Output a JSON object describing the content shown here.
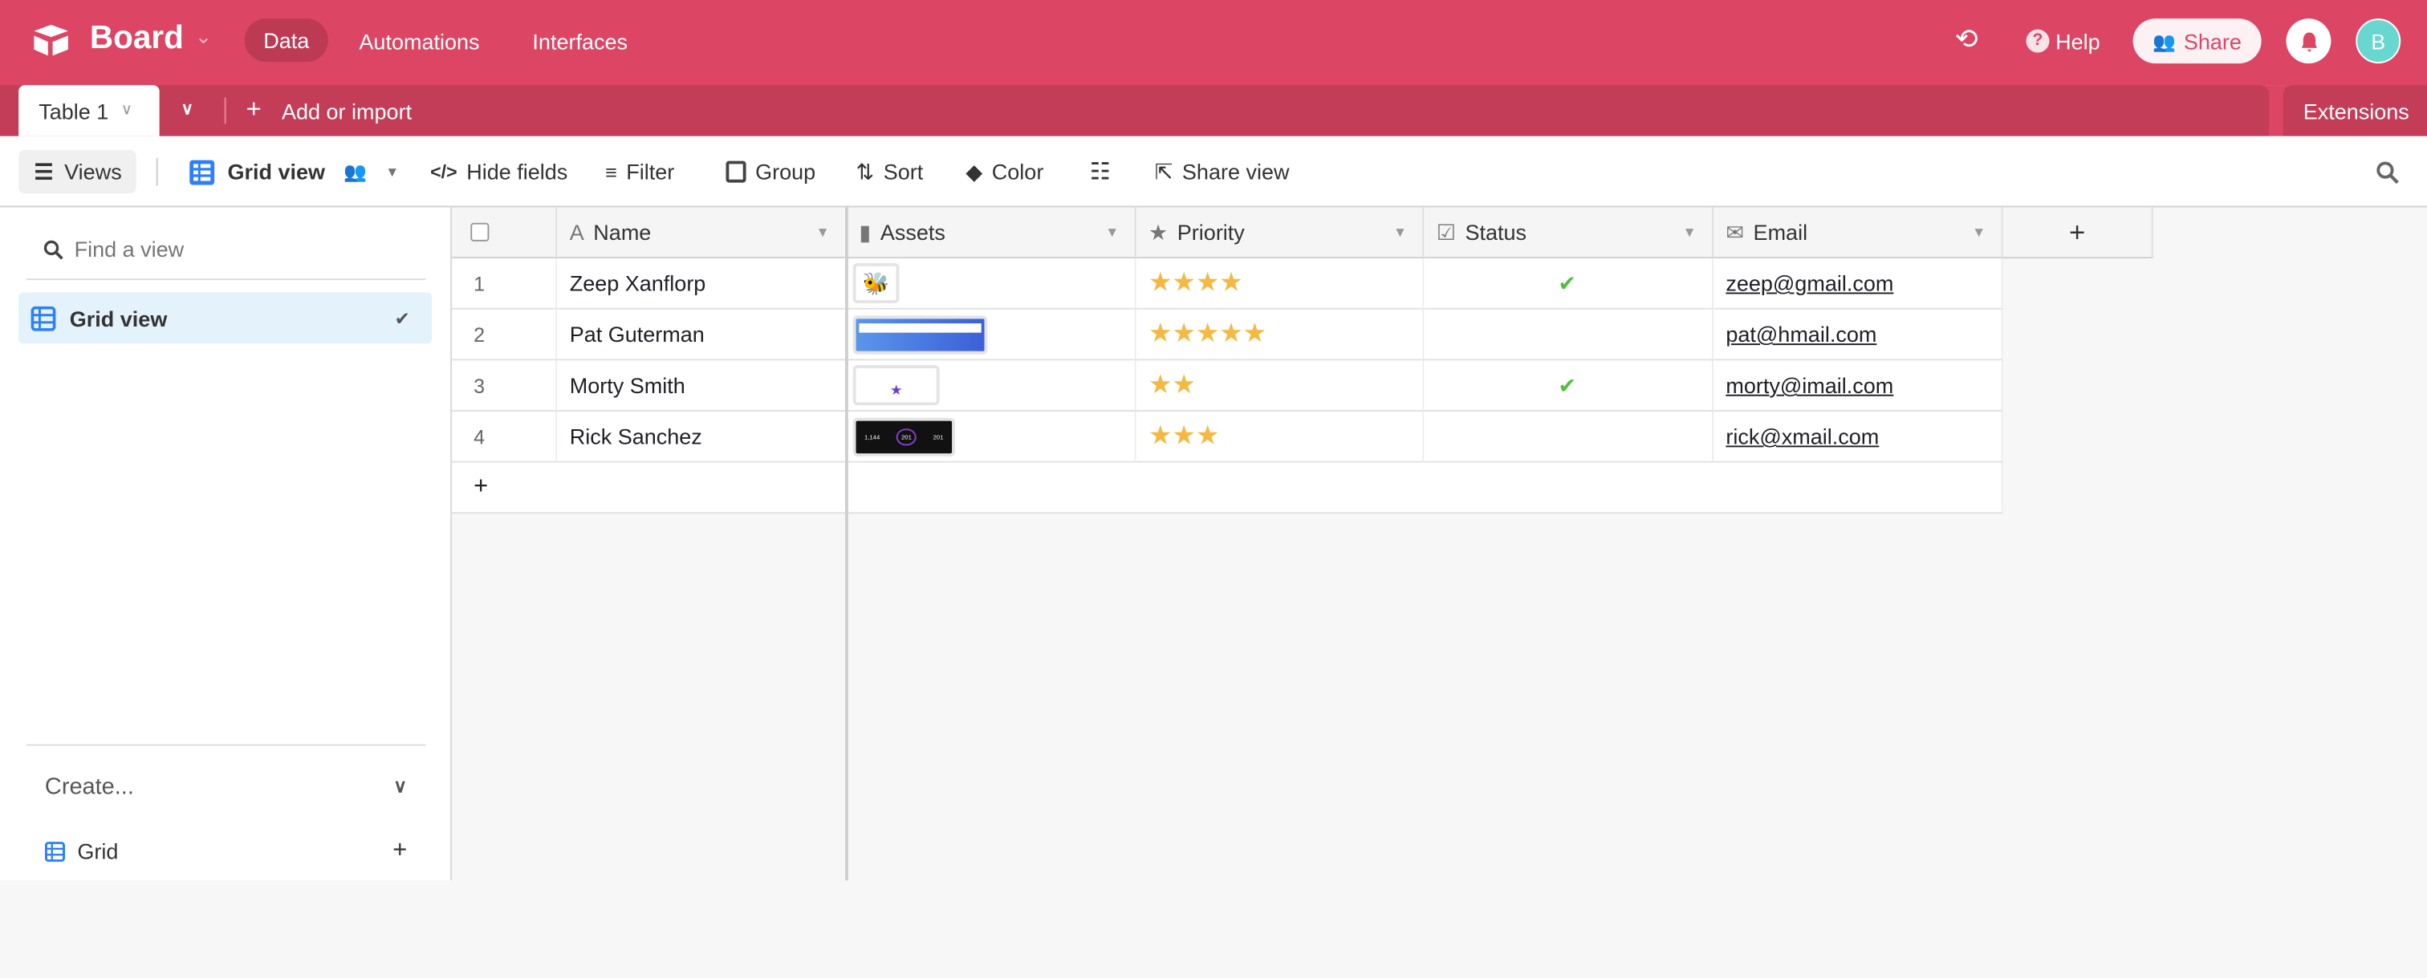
{
  "app": {
    "title": "Board",
    "nav": [
      "Data",
      "Automations",
      "Interfaces"
    ],
    "help": "Help",
    "share": "Share",
    "avatar": "B",
    "brand_color": "#dc4563",
    "avatar_color": "#68d7d0"
  },
  "tabs": {
    "table": "Table 1",
    "add": "Add or import",
    "extensions": "Extensions"
  },
  "toolbar": {
    "views": "Views",
    "view_name": "Grid view",
    "hide_fields": "Hide fields",
    "filter": "Filter",
    "group": "Group",
    "sort": "Sort",
    "color": "Color",
    "share_view": "Share view"
  },
  "sidebar": {
    "find_placeholder": "Find a view",
    "items": [
      {
        "label": "Grid view",
        "selected": true
      }
    ],
    "create": "Create...",
    "create_items": [
      {
        "label": "Grid"
      }
    ]
  },
  "grid": {
    "columns": [
      {
        "label": "Name",
        "icon": "text-icon"
      },
      {
        "label": "Assets",
        "icon": "file-icon"
      },
      {
        "label": "Priority",
        "icon": "star-icon"
      },
      {
        "label": "Status",
        "icon": "checkbox-icon"
      },
      {
        "label": "Email",
        "icon": "mail-icon"
      }
    ],
    "rows": [
      {
        "num": "1",
        "name": "Zeep Xanflorp",
        "asset": "bee",
        "priority": 4,
        "status": true,
        "email": "zeep@gmail.com"
      },
      {
        "num": "2",
        "name": "Pat Guterman",
        "asset": "blue-screenshot",
        "priority": 5,
        "status": false,
        "email": "pat@hmail.com"
      },
      {
        "num": "3",
        "name": "Morty Smith",
        "asset": "star-logo",
        "priority": 2,
        "status": true,
        "email": "morty@imail.com"
      },
      {
        "num": "4",
        "name": "Rick Sanchez",
        "asset": "dark-stats",
        "priority": 3,
        "status": false,
        "email": "rick@xmail.com"
      }
    ],
    "star_color": "#f4b942",
    "check_color": "#4fbf3c"
  }
}
